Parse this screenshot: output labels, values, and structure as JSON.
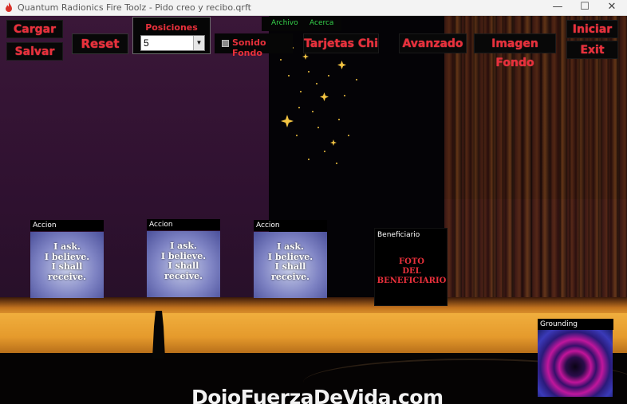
{
  "window": {
    "title": "Quantum Radionics Fire Toolz - Pido creo y recibo.qrft",
    "minimize_glyph": "—",
    "maximize_glyph": "☐",
    "close_glyph": "✕"
  },
  "toolbar": {
    "cargar": "Cargar",
    "salvar": "Salvar",
    "reset": "Reset",
    "posiciones_label": "Posiciones",
    "posiciones_value": "5",
    "sonido_fondo": "Sonido Fondo",
    "tarjetas_chi": "Tarjetas Chi",
    "avanzado": "Avanzado",
    "imagen_fondo": "Imagen Fondo",
    "iniciar": "Iniciar",
    "exit": "Exit"
  },
  "menu": {
    "archivo": "Archivo",
    "acerca": "Acerca"
  },
  "cards": [
    {
      "label": "Accion",
      "text": "I ask.\nI believe.\nI shall\nreceive."
    },
    {
      "label": "Accion",
      "text": "I ask.\nI believe.\nI shall\nreceive."
    },
    {
      "label": "Accion",
      "text": "I ask.\nI believe.\nI shall\nreceive."
    }
  ],
  "beneficiario": {
    "label": "Beneficiario",
    "photo_text": "FOTO\nDEL\nBENEFICIARIO"
  },
  "grounding": {
    "label": "Grounding"
  },
  "watermark": "DojoFuerzaDeVida.com",
  "colors": {
    "accent_red": "#e8303b",
    "menu_green": "#35d14a",
    "moon_yellow": "#f4c542"
  }
}
